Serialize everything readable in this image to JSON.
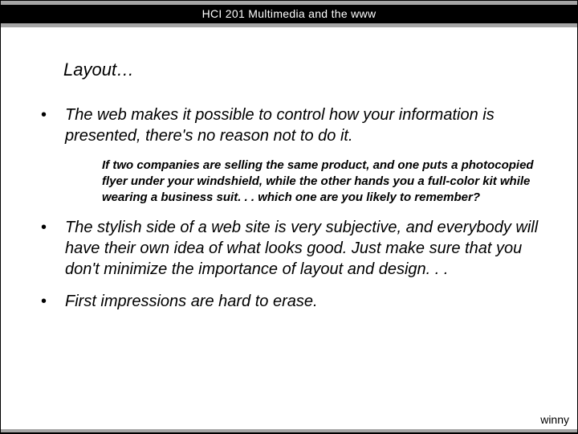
{
  "header": {
    "title": "HCI 201 Multimedia and the www"
  },
  "slide": {
    "heading": "Layout…",
    "bullets": [
      {
        "text": "The web makes it possible to control how your information is presented, there's no reason not to do it.",
        "sub": "If two companies are selling the same product, and one puts a photocopied flyer under your windshield, while the other hands you a full-color kit while wearing a business suit. . . which one are you likely to remember?"
      },
      {
        "text": "The stylish side of a web site is very subjective, and everybody will have their own idea of what looks good. Just make sure that you don't minimize the importance of layout and design. . ."
      },
      {
        "text": "First impressions are hard to erase."
      }
    ]
  },
  "footer": {
    "author": "winny"
  },
  "glyphs": {
    "bullet": "•"
  }
}
